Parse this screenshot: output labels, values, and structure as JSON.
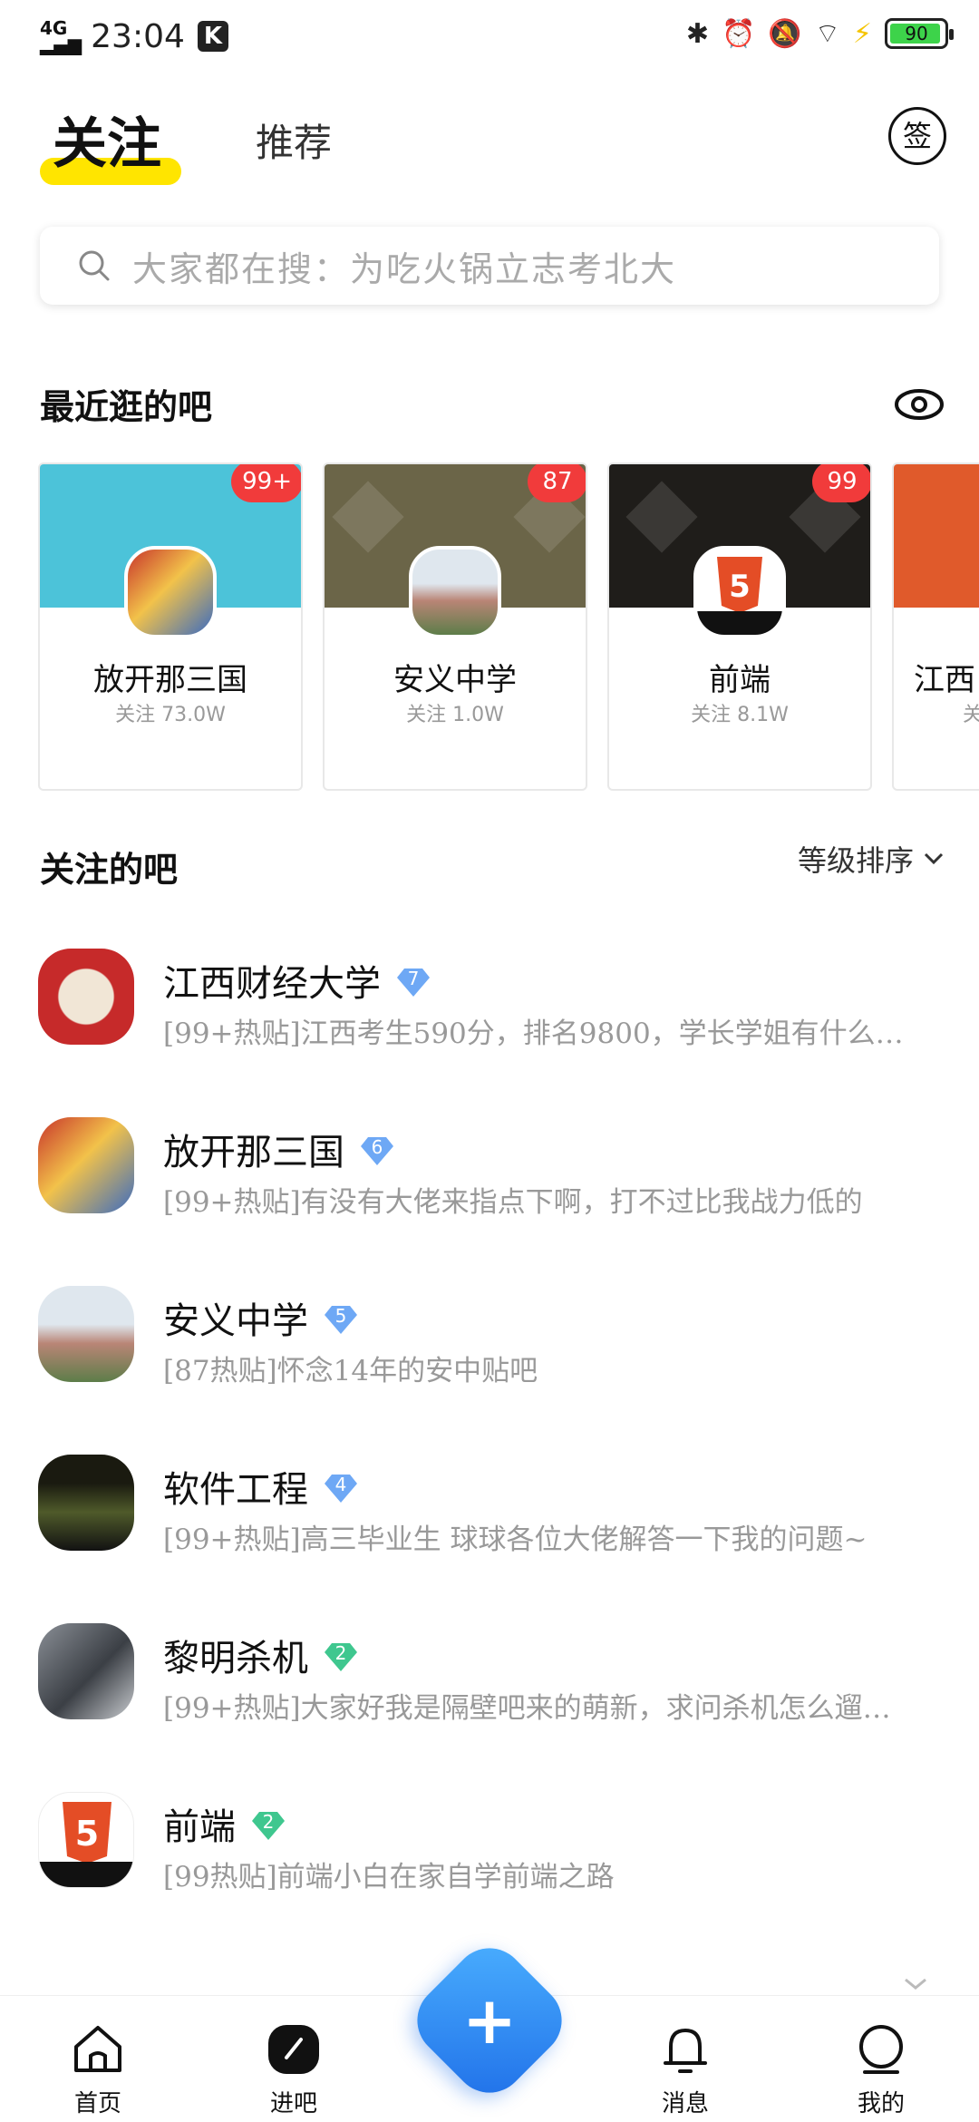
{
  "status_bar": {
    "network": "4G HD",
    "time": "23:04",
    "k_icon": "K",
    "battery": "90"
  },
  "header": {
    "tab_active": "关注",
    "tab_other": "推荐",
    "sign_label": "签"
  },
  "search": {
    "placeholder": "大家都在搜：为吃火锅立志考北大"
  },
  "recent": {
    "title": "最近逛的吧",
    "cards": [
      {
        "name": "放开那三国",
        "follow": "关注 73.0W",
        "badge": "99+",
        "banner": "#4cc3d9"
      },
      {
        "name": "安义中学",
        "follow": "关注 1.0W",
        "badge": "87",
        "banner": "#6b6548"
      },
      {
        "name": "前端",
        "follow": "关注 8.1W",
        "badge": "99",
        "banner": "#1f1d1a"
      },
      {
        "name": "江西",
        "follow": "关",
        "badge": "",
        "banner": "#e05a2b"
      }
    ]
  },
  "followed": {
    "title": "关注的吧",
    "sort_label": "等级排序",
    "items": [
      {
        "name": "江西财经大学",
        "level": "7",
        "desc": "[99+热贴]江西考生590分，排名9800，学长学姐有什么…"
      },
      {
        "name": "放开那三国",
        "level": "6",
        "desc": "[99+热贴]有没有大佬来指点下啊，打不过比我战力低的"
      },
      {
        "name": "安义中学",
        "level": "5",
        "desc": "[87热贴]怀念14年的安中贴吧"
      },
      {
        "name": "软件工程",
        "level": "4",
        "desc": "[99+热贴]高三毕业生 球球各位大佬解答一下我的问题~"
      },
      {
        "name": "黎明杀机",
        "level": "2",
        "desc": "[99+热贴]大家好我是隔壁吧来的萌新，求问杀机怎么遛…"
      },
      {
        "name": "前端",
        "level": "2",
        "desc": "[99热贴]前端小白在家自学前端之路"
      }
    ]
  },
  "nav": {
    "home": "首页",
    "enter": "进吧",
    "message": "消息",
    "mine": "我的",
    "fab": "+"
  },
  "colors": {
    "accent": "#ffe500",
    "badge_red": "#f13b3b",
    "fab_blue": "#1f6fe8",
    "level_blue": "#6ea8f5",
    "level_green": "#3fc78f"
  },
  "icons": [
    "search-icon",
    "eye-icon",
    "chevron-down-icon",
    "home-icon",
    "enter-bar-icon",
    "bell-icon",
    "profile-icon",
    "plus-icon",
    "sign-in-icon",
    "bluetooth-icon",
    "alarm-icon",
    "mute-icon",
    "wifi-icon"
  ]
}
